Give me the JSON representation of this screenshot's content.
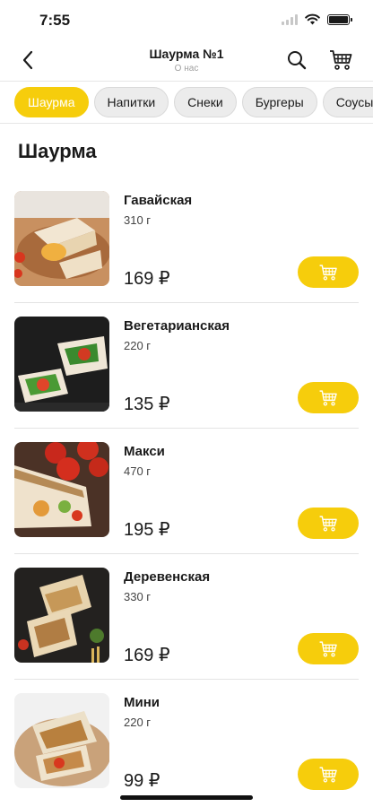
{
  "status": {
    "time": "7:55"
  },
  "header": {
    "title": "Шаурма №1",
    "subtitle": "О нас"
  },
  "categories": [
    "Шаурма",
    "Напитки",
    "Снеки",
    "Бургеры",
    "Соусы"
  ],
  "active_category": "Шаурма",
  "section": {
    "title": "Шаурма"
  },
  "products": [
    {
      "name": "Гавайская",
      "weight": "310 г",
      "price": "169 ₽"
    },
    {
      "name": "Вегетарианская",
      "weight": "220 г",
      "price": "135 ₽"
    },
    {
      "name": "Макси",
      "weight": "470 г",
      "price": "195 ₽"
    },
    {
      "name": "Деревенская",
      "weight": "330 г",
      "price": "169 ₽"
    },
    {
      "name": "Мини",
      "weight": "220 г",
      "price": "99 ₽"
    }
  ],
  "colors": {
    "accent": "#f6cd0c",
    "chip_bg": "#ececec",
    "divider": "#e3e3e3"
  },
  "icons": {
    "back": "chevron-left-icon",
    "search": "search-icon",
    "cart": "cart-icon",
    "add": "add-to-cart-icon"
  }
}
